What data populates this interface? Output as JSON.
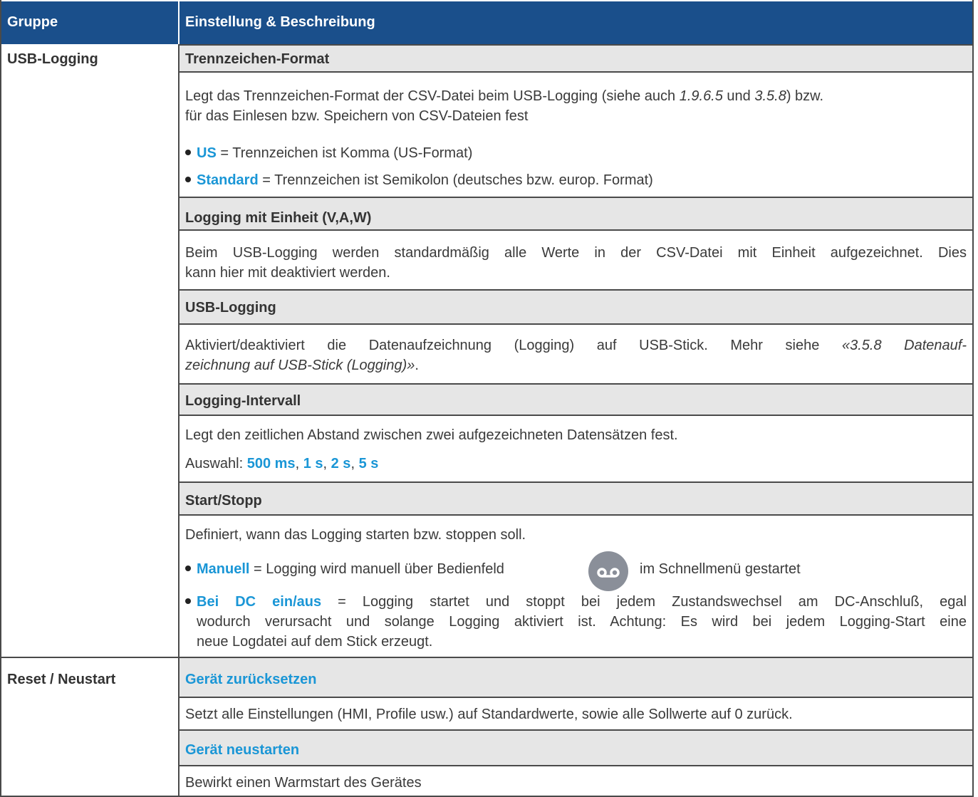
{
  "header": {
    "col1": "Gruppe",
    "col2": "Einstellung & Beschreibung"
  },
  "groups": [
    {
      "label": "USB-Logging"
    },
    {
      "label": "Reset / Neustart"
    }
  ],
  "items": [
    {
      "title": "Trennzeichen-Format",
      "desc_parts": [
        "Legt das Trennzeichen-Format der CSV-Datei beim USB-Logging (siehe auch ",
        "1.9.6.5",
        " und ",
        "3.5.8",
        ") bzw.",
        "für das Einlesen bzw. Speichern von CSV-Dateien fest"
      ],
      "bullets": [
        {
          "key": "US",
          "text": " = Trennzeichen ist Komma (US-Format)"
        },
        {
          "key": "Standard",
          "text": " = Trennzeichen ist Semikolon (deutsches bzw. europ. Format)"
        }
      ]
    },
    {
      "title": "Logging mit Einheit (V,A,W)",
      "desc_lines": [
        "Beim USB-Logging werden standardmäßig alle Werte in der CSV-Datei mit Einheit aufgezeichnet. Dies",
        "kann hier mit deaktiviert werden."
      ]
    },
    {
      "title": "USB-Logging",
      "desc_line1_plain": "Aktiviert/deaktiviert die Datenaufzeichnung (Logging) auf USB-Stick. Mehr siehe ",
      "desc_line1_em": "«3.5.8 Datenauf-",
      "desc_line2_em": "zeichnung auf USB-Stick (Logging)»",
      "desc_line2_end": "."
    },
    {
      "title": "Logging-Intervall",
      "desc": "Legt den zeitlichen Abstand zwischen zwei aufgezeichneten Datensätzen fest.",
      "choice_label": "Auswahl: ",
      "choices": [
        "500 ms",
        "1 s",
        "2 s",
        "5 s"
      ],
      "sep": ", "
    },
    {
      "title": "Start/Stopp",
      "desc": "Definiert, wann das Logging starten bzw. stoppen soll.",
      "b1_key": "Manuell",
      "b1_pre": " = Logging wird manuell über Bedienfeld",
      "b1_post": "im Schnellmenü gestartet",
      "b2_key": "Bei DC ein/aus",
      "b2_line1": " = Logging startet und stoppt bei jedem Zustandswechsel am DC-Anschluß, egal",
      "b2_line2": "wodurch verursacht und solange Logging aktiviert ist. Achtung: Es wird bei jedem Logging-Start eine",
      "b2_line3": "neue Logdatei auf dem Stick erzeugt."
    },
    {
      "title": "Gerät zurücksetzen",
      "desc": "Setzt alle Einstellungen (HMI, Profile usw.) auf Standardwerte, sowie alle Sollwerte auf 0 zurück."
    },
    {
      "title": "Gerät neustarten",
      "desc": "Bewirkt einen Warmstart des Gerätes"
    }
  ],
  "icons": {
    "logging_button": "voicemail-icon"
  },
  "colors": {
    "header_bg": "#1a4f8b",
    "accent": "#1a96d6",
    "title_row_bg": "#e6e6e6"
  }
}
